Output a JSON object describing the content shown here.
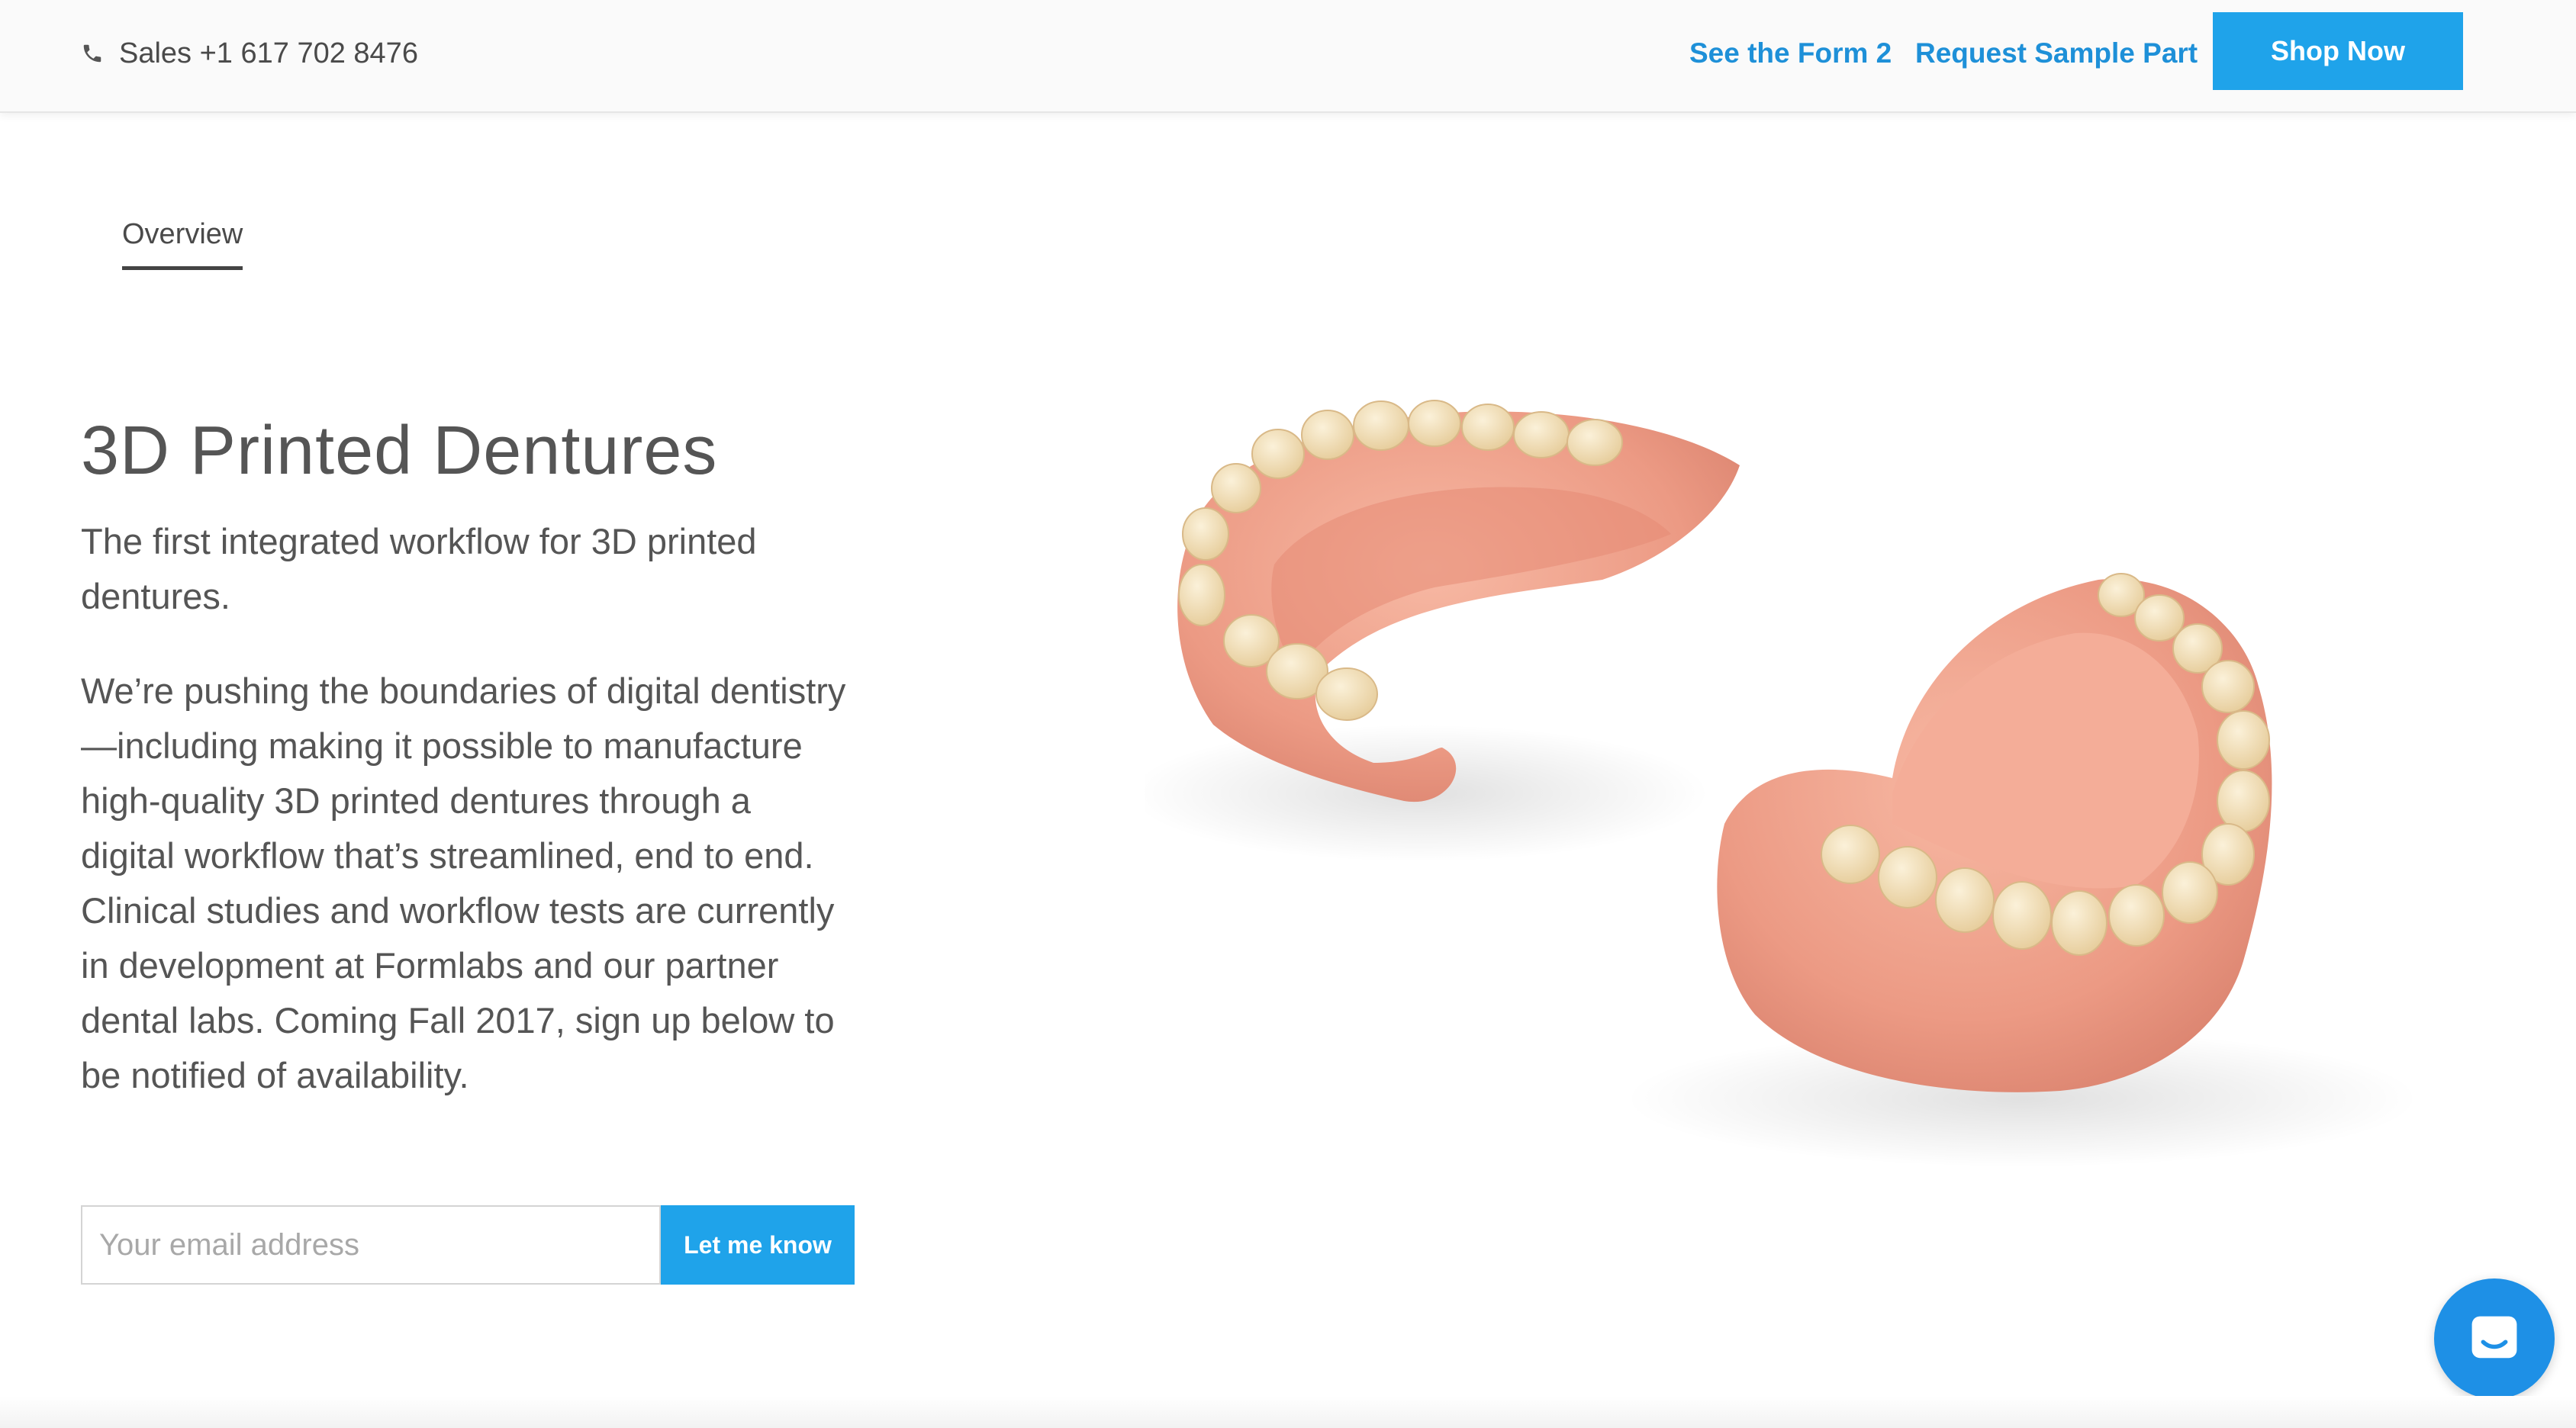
{
  "header": {
    "phone_icon": "phone-icon",
    "sales_label": "Sales +1 617 702 8476",
    "links": [
      {
        "label": "See the Form 2"
      },
      {
        "label": "Request Sample Part"
      }
    ],
    "shop_label": "Shop Now"
  },
  "tabs": [
    {
      "label": "Overview"
    }
  ],
  "main": {
    "title": "3D Printed Dentures",
    "subtitle": "The first integrated workflow for 3D printed dentures.",
    "body": "We’re pushing the boundaries of digital dentistry—including making it possible to manufacture high-quality 3D printed dentures through a digital workflow that’s streamlined, end to end. Clinical studies and workflow tests are currently in development at Formlabs and our partner dental labs. Coming Fall 2017, sign up below to be notified of availability.",
    "email": {
      "value": "",
      "placeholder": "Your email address"
    },
    "cta_label": "Let me know"
  },
  "hero_image": "dentures-photo",
  "chat_icon": "chat-icon",
  "colors": {
    "accent": "#1fa3ea",
    "link": "#1e90d8",
    "gum": "#f0a48e",
    "teeth": "#f4e2bd"
  }
}
